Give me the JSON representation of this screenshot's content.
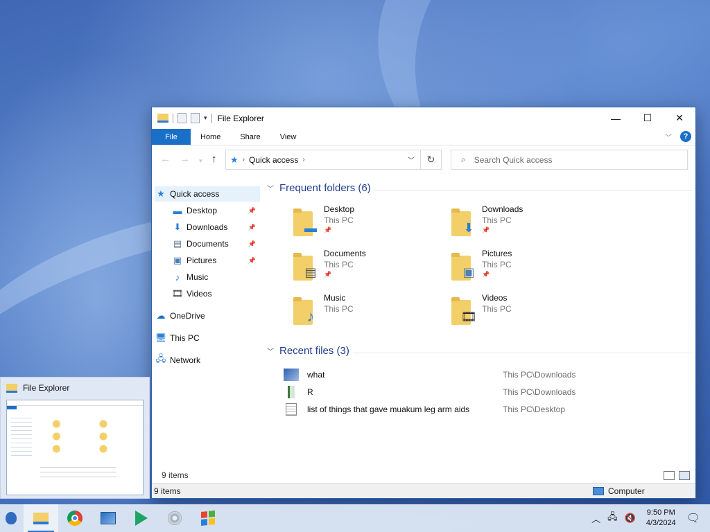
{
  "window": {
    "title": "File Explorer",
    "ribbon_tabs": [
      "File",
      "Home",
      "Share",
      "View"
    ],
    "help_label": "?"
  },
  "address": {
    "crumb": "Quick access",
    "search_placeholder": "Search Quick access"
  },
  "nav_pane": {
    "items": [
      {
        "label": "Quick access",
        "icon": "star-icon",
        "pinned": false
      },
      {
        "label": "Desktop",
        "icon": "desktop-icon",
        "pinned": true
      },
      {
        "label": "Downloads",
        "icon": "download-icon",
        "pinned": true
      },
      {
        "label": "Documents",
        "icon": "document-icon",
        "pinned": true
      },
      {
        "label": "Pictures",
        "icon": "picture-icon",
        "pinned": true
      },
      {
        "label": "Music",
        "icon": "music-icon",
        "pinned": false
      },
      {
        "label": "Videos",
        "icon": "video-icon",
        "pinned": false
      },
      {
        "label": "OneDrive",
        "icon": "cloud-icon",
        "pinned": false
      },
      {
        "label": "This PC",
        "icon": "computer-icon",
        "pinned": false
      },
      {
        "label": "Network",
        "icon": "network-icon",
        "pinned": false
      }
    ]
  },
  "frequent": {
    "heading": "Frequent folders (6)",
    "folders": [
      {
        "name": "Desktop",
        "location": "This PC",
        "pinned": true
      },
      {
        "name": "Downloads",
        "location": "This PC",
        "pinned": true
      },
      {
        "name": "Documents",
        "location": "This PC",
        "pinned": true
      },
      {
        "name": "Pictures",
        "location": "This PC",
        "pinned": true
      },
      {
        "name": "Music",
        "location": "This PC",
        "pinned": false
      },
      {
        "name": "Videos",
        "location": "This PC",
        "pinned": false
      }
    ]
  },
  "recent": {
    "heading": "Recent files (3)",
    "files": [
      {
        "name": "what",
        "path": "This PC\\Downloads"
      },
      {
        "name": "R",
        "path": "This PC\\Downloads"
      },
      {
        "name": "list of things that gave muakum leg arm aids",
        "path": "This PC\\Desktop"
      }
    ]
  },
  "status": {
    "item_count": "9 items",
    "bottom_count": "9 items",
    "computer_label": "Computer"
  },
  "preview": {
    "title": "File Explorer"
  },
  "taskbar": {
    "time": "9:50 PM",
    "date": "4/3/2024"
  },
  "colors": {
    "accent": "#1a6fc7",
    "heading": "#1e3c8f",
    "folder": "#f3cf69"
  }
}
